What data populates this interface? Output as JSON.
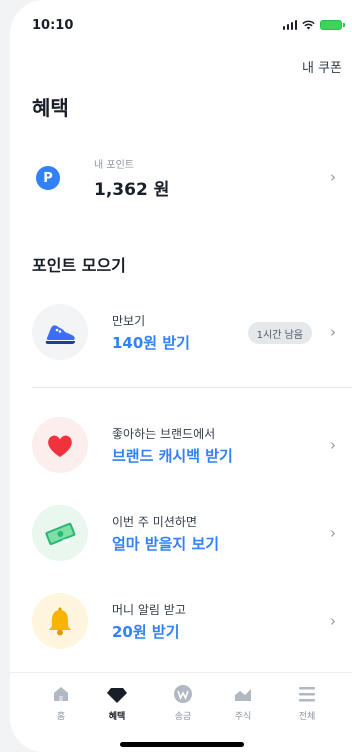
{
  "status_bar": {
    "time": "10:10"
  },
  "header": {
    "coupon_link": "내 쿠폰",
    "title": "혜택"
  },
  "points": {
    "badge": "P",
    "label": "내 포인트",
    "value": "1,362 원"
  },
  "section": {
    "title": "포인트 모으기"
  },
  "items": [
    {
      "subtitle": "만보기",
      "title": "140원 받기",
      "badge": "1시간 남음",
      "icon": "sneaker-icon"
    },
    {
      "subtitle": "좋아하는 브랜드에서",
      "title": "브랜드 캐시백 받기",
      "icon": "heart-icon"
    },
    {
      "subtitle": "이번 주 미션하면",
      "title": "얼마 받을지 보기",
      "icon": "money-icon"
    },
    {
      "subtitle": "머니 알림 받고",
      "title": "20원 받기",
      "icon": "bell-icon"
    }
  ],
  "tabs": [
    {
      "label": "홈",
      "icon": "home-icon"
    },
    {
      "label": "혜택",
      "icon": "gem-icon",
      "active": true
    },
    {
      "label": "송금",
      "icon": "won-transfer-icon"
    },
    {
      "label": "주식",
      "icon": "stock-chart-icon"
    },
    {
      "label": "전체",
      "icon": "menu-icon"
    }
  ],
  "colors": {
    "accent": "#3182f6",
    "text": "#191f28",
    "muted": "#8b95a1"
  }
}
